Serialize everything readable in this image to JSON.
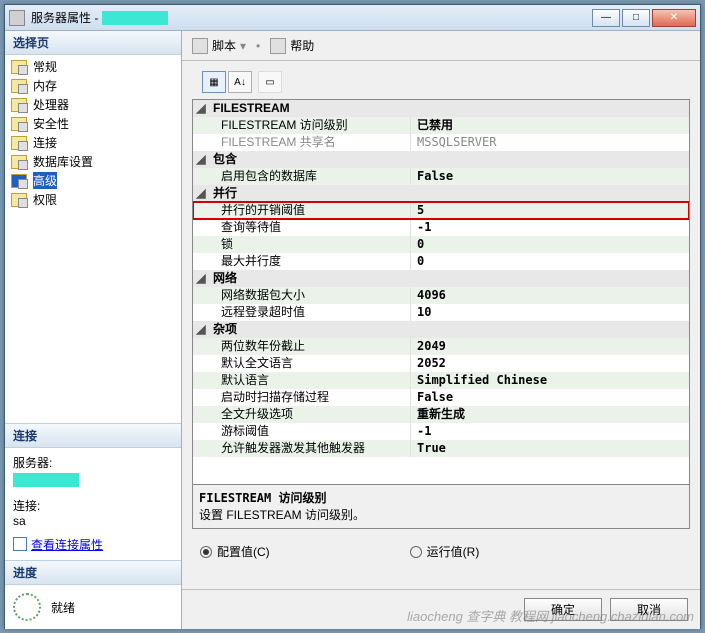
{
  "window": {
    "title": "服务器属性 -",
    "btn_min": "—",
    "btn_max": "□",
    "btn_close": "✕"
  },
  "left": {
    "header": "选择页",
    "nav": [
      "常规",
      "内存",
      "处理器",
      "安全性",
      "连接",
      "数据库设置",
      "高级",
      "权限"
    ],
    "selected_index": 6,
    "conn_header": "连接",
    "server_label": "服务器:",
    "conn_label": "连接:",
    "conn_user": "sa",
    "view_props": "查看连接属性",
    "progress_header": "进度",
    "progress_status": "就绪"
  },
  "toolbar": {
    "script": "脚本",
    "help": "帮助"
  },
  "grid_tb": {
    "cat": "▦",
    "az": "A↓",
    "pg": "▭"
  },
  "props": {
    "categories": [
      {
        "name": "FILESTREAM",
        "rows": [
          {
            "label": "FILESTREAM 访问级别",
            "value": "已禁用",
            "alt": true
          },
          {
            "label": "FILESTREAM 共享名",
            "value": "MSSQLSERVER",
            "disabled": true
          }
        ]
      },
      {
        "name": "包含",
        "rows": [
          {
            "label": "启用包含的数据库",
            "value": "False",
            "alt": true
          }
        ]
      },
      {
        "name": "并行",
        "rows": [
          {
            "label": "并行的开销阈值",
            "value": "5",
            "alt": true,
            "highlight": true
          },
          {
            "label": "查询等待值",
            "value": "-1"
          },
          {
            "label": "锁",
            "value": "0",
            "alt": true
          },
          {
            "label": "最大并行度",
            "value": "0"
          }
        ]
      },
      {
        "name": "网络",
        "rows": [
          {
            "label": "网络数据包大小",
            "value": "4096",
            "alt": true
          },
          {
            "label": "远程登录超时值",
            "value": "10"
          }
        ]
      },
      {
        "name": "杂项",
        "rows": [
          {
            "label": "两位数年份截止",
            "value": "2049",
            "alt": true
          },
          {
            "label": "默认全文语言",
            "value": "2052"
          },
          {
            "label": "默认语言",
            "value": "Simplified Chinese",
            "alt": true
          },
          {
            "label": "启动时扫描存储过程",
            "value": "False"
          },
          {
            "label": "全文升级选项",
            "value": "重新生成",
            "alt": true
          },
          {
            "label": "游标阈值",
            "value": "-1"
          },
          {
            "label": "允许触发器激发其他触发器",
            "value": "True",
            "alt": true
          }
        ]
      }
    ]
  },
  "desc": {
    "title": "FILESTREAM 访问级别",
    "text": "设置 FILESTREAM 访问级别。"
  },
  "radios": {
    "config": "配置值(C)",
    "runtime": "运行值(R)"
  },
  "footer": {
    "ok": "确定",
    "cancel": "取消"
  },
  "watermark": "liaocheng 查字典 教程网 jiaocheng.chazidian.com"
}
